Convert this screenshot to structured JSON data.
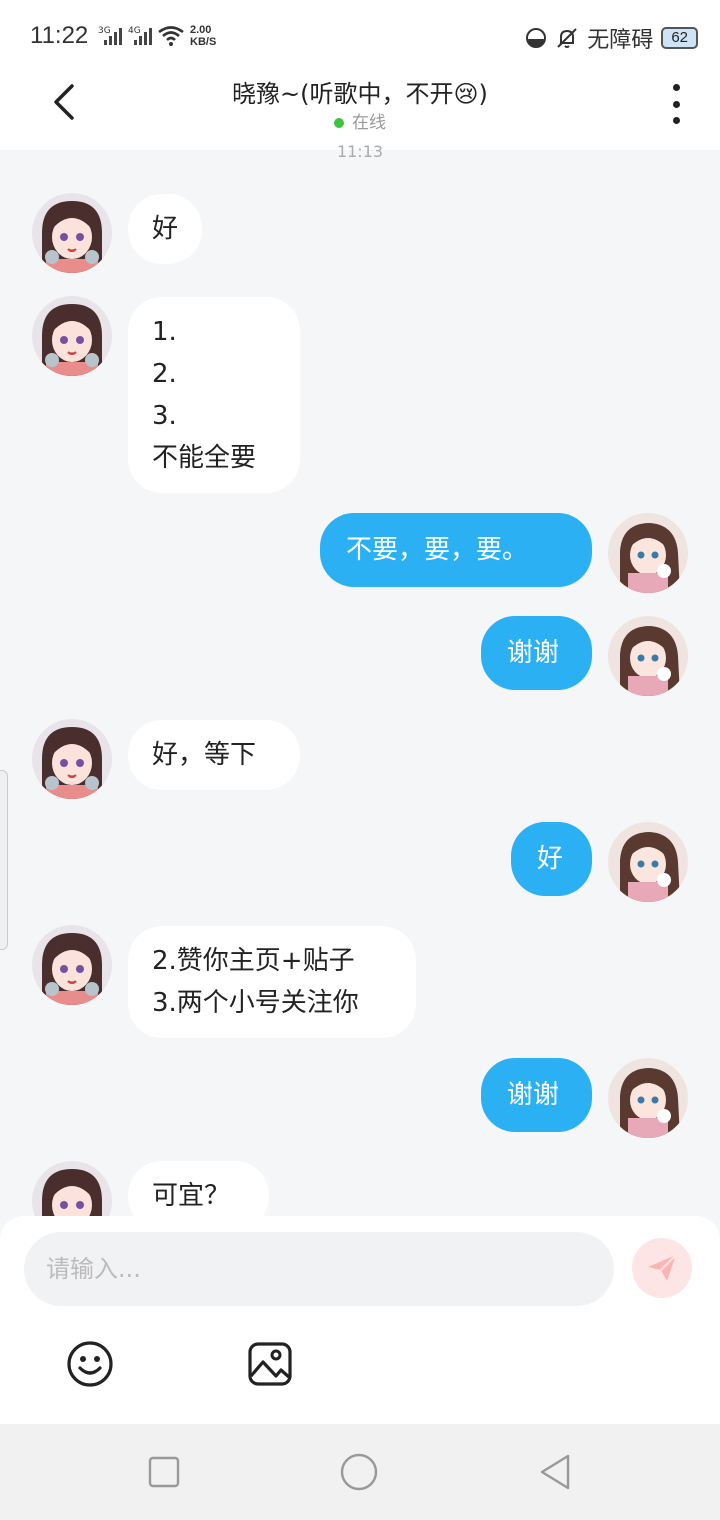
{
  "status_bar": {
    "time": "11:22",
    "network1": "3G",
    "network2": "4G",
    "speed_value": "2.00",
    "speed_unit": "KB/S",
    "accessibility": "无障碍",
    "battery": "62"
  },
  "header": {
    "title": "晓豫~(听歌中，不开😢)",
    "status": "在线",
    "status_color": "#3ec43e"
  },
  "chat": {
    "partial_timestamp": "11:13",
    "messages": [
      {
        "side": "in",
        "text": "好"
      },
      {
        "side": "in",
        "text": "1.\n2.\n3.\n不能全要"
      },
      {
        "side": "out",
        "text": "不要，要，要。"
      },
      {
        "side": "out",
        "text": "谢谢"
      },
      {
        "side": "in",
        "text": "好，等下"
      },
      {
        "side": "out",
        "text": "好"
      },
      {
        "side": "in",
        "text": "2.赞你主页+贴子\n3.两个小号关注你"
      },
      {
        "side": "out",
        "text": "谢谢"
      },
      {
        "side": "in",
        "text": "可宜？"
      }
    ]
  },
  "input": {
    "placeholder": "请输入..."
  },
  "icons": {
    "back": "back-arrow-icon",
    "more": "more-vertical-icon",
    "send": "send-icon",
    "emoji": "emoji-icon",
    "image": "image-icon",
    "nav_recent": "square-icon",
    "nav_home": "circle-icon",
    "nav_back": "triangle-icon"
  },
  "colors": {
    "outgoing_bubble": "#2bb0f4",
    "incoming_bubble": "#ffffff",
    "background": "#f4f6f8"
  }
}
